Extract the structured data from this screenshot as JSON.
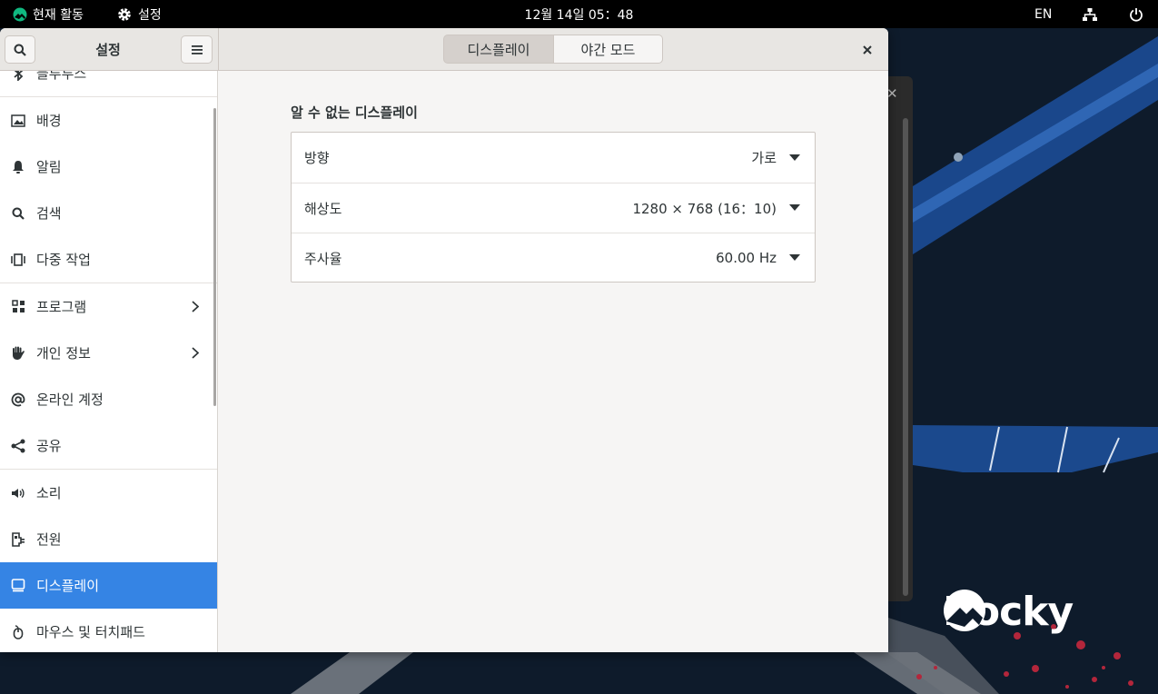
{
  "topbar": {
    "activities": "현재 활동",
    "app_name": "설정",
    "clock": "12월 14일  05：48",
    "language": "EN"
  },
  "headerbar": {
    "title": "설정",
    "tabs": [
      {
        "label": "디스플레이",
        "active": true
      },
      {
        "label": "야간 모드",
        "active": false
      }
    ]
  },
  "sidebar": {
    "items": [
      {
        "label": "블루투스",
        "icon": "bluetooth-icon"
      },
      {
        "label": "배경",
        "icon": "background-icon"
      },
      {
        "label": "알림",
        "icon": "bell-icon"
      },
      {
        "label": "검색",
        "icon": "search-icon"
      },
      {
        "label": "다중 작업",
        "icon": "multitasking-icon"
      },
      {
        "label": "프로그램",
        "icon": "apps-grid-icon",
        "has_submenu": true
      },
      {
        "label": "개인 정보",
        "icon": "hand-icon",
        "has_submenu": true
      },
      {
        "label": "온라인 계정",
        "icon": "at-icon"
      },
      {
        "label": "공유",
        "icon": "share-icon"
      },
      {
        "label": "소리",
        "icon": "speaker-icon"
      },
      {
        "label": "전원",
        "icon": "power-plug-icon"
      },
      {
        "label": "디스플레이",
        "icon": "monitor-icon",
        "selected": true
      },
      {
        "label": "마우스 및 터치패드",
        "icon": "mouse-icon"
      }
    ]
  },
  "display": {
    "section_title": "알 수 없는 디스플레이",
    "rows": [
      {
        "label": "방향",
        "value": "가로"
      },
      {
        "label": "해상도",
        "value": "1280 × 768 (16：10)"
      },
      {
        "label": "주사율",
        "value": "60.00 Hz"
      }
    ]
  },
  "desktop": {
    "logo_text": "Rocky"
  },
  "colors": {
    "accent": "#3584e4",
    "topbar": "#000000",
    "window_bg": "#f6f5f4"
  }
}
